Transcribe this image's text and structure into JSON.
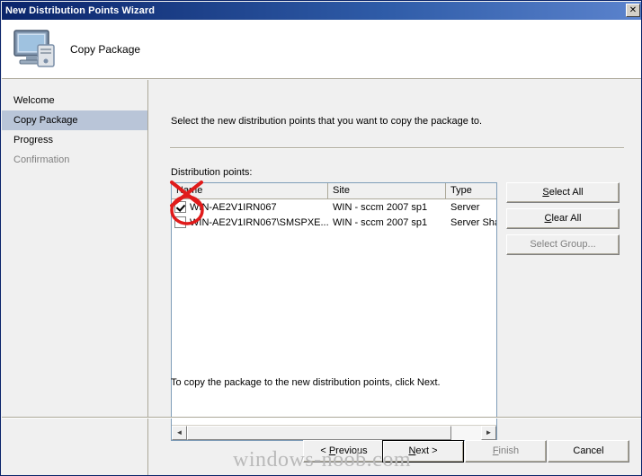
{
  "window": {
    "title": "New Distribution Points Wizard",
    "close_label": "✕"
  },
  "header": {
    "title": "Copy Package",
    "icon": "computer-monitor-icon"
  },
  "sidebar": {
    "items": [
      {
        "label": "Welcome",
        "state": "normal"
      },
      {
        "label": "Copy Package",
        "state": "selected"
      },
      {
        "label": "Progress",
        "state": "normal"
      },
      {
        "label": "Confirmation",
        "state": "disabled"
      }
    ]
  },
  "main": {
    "instruction": "Select the new distribution points that you want to copy the package to.",
    "list_label": "Distribution points:",
    "note": "To copy the package to the new distribution points, click Next.",
    "columns": [
      "Name",
      "Site",
      "Type"
    ],
    "rows": [
      {
        "checked": true,
        "name": "WIN-AE2V1IRN067",
        "site": "WIN - sccm 2007 sp1",
        "type": "Server"
      },
      {
        "checked": false,
        "name": "WIN-AE2V1IRN067\\SMSPXE...",
        "site": "WIN - sccm 2007 sp1",
        "type": "Server Sha"
      }
    ],
    "side_buttons": [
      {
        "label": "Select All",
        "accel": "S",
        "disabled": false
      },
      {
        "label": "Clear All",
        "accel": "C",
        "disabled": false
      },
      {
        "label": "Select Group...",
        "accel": "G",
        "disabled": true
      }
    ],
    "scroll_left": "◄",
    "scroll_right": "►"
  },
  "footer": {
    "buttons": [
      {
        "label": "< Previous",
        "accel": "P",
        "default": false,
        "disabled": false
      },
      {
        "label": "Next >",
        "accel": "N",
        "default": true,
        "disabled": false
      },
      {
        "label": "Finish",
        "accel": "F",
        "default": false,
        "disabled": true
      },
      {
        "label": "Cancel",
        "accel": "",
        "default": false,
        "disabled": false
      }
    ]
  },
  "watermark": "windows-noob.com",
  "colors": {
    "titlebar_start": "#0a246a",
    "titlebar_end": "#5b83cd",
    "selected_nav": "#b9c5d8",
    "annotation_red": "#e01b1b",
    "dialog_face": "#f0f0f0"
  }
}
